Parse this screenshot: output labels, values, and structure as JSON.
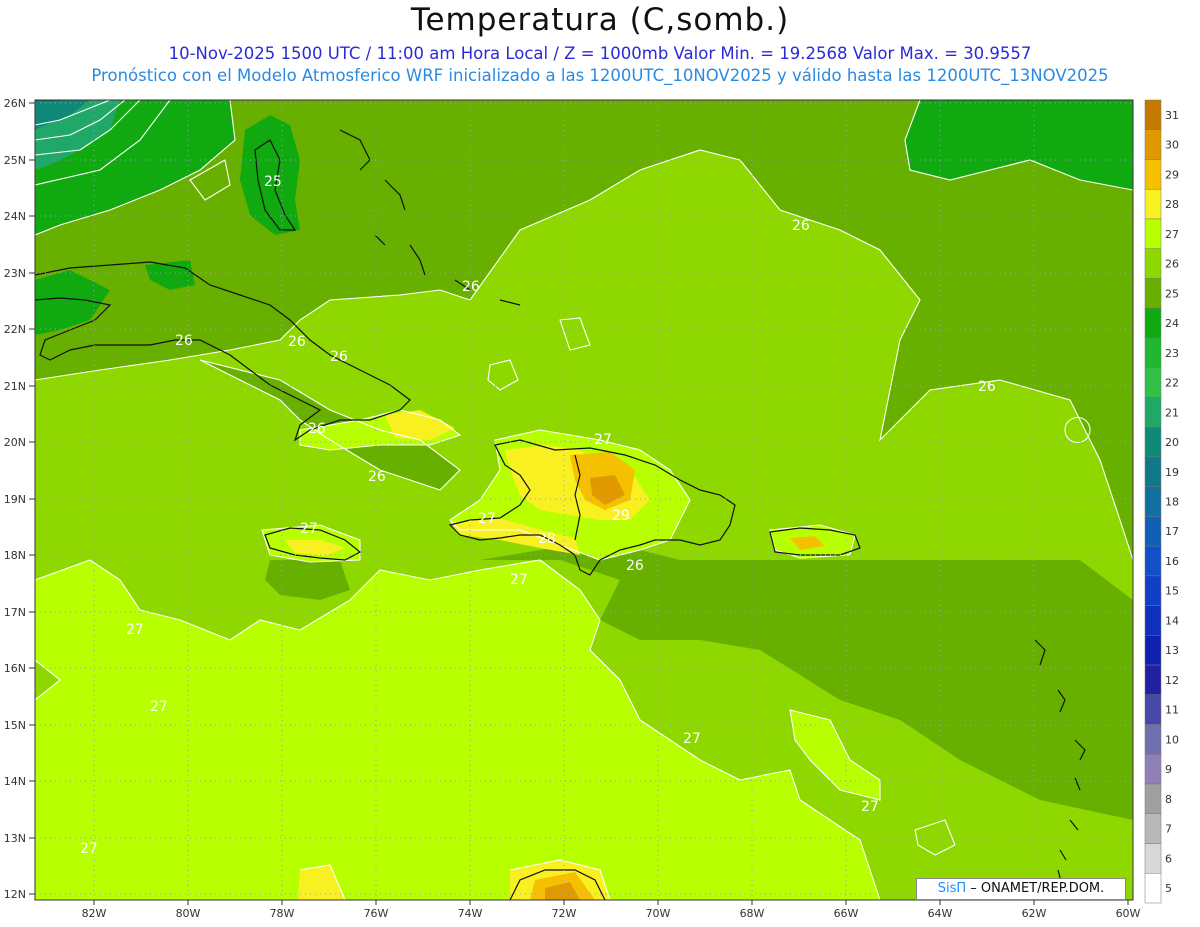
{
  "title": "Temperatura (C,somb.)",
  "subtitle_line1": "10-Nov-2025 1500 UTC / 11:00 am Hora Local / Z = 1000mb  Valor Min. = 19.2568  Valor Max. = 30.9557",
  "subtitle_line2": "Pronóstico con el Modelo Atmosferico WRF inicializado a las 1200UTC_10NOV2025 y válido hasta las  1200UTC_13NOV2025",
  "credit": {
    "brand": "SisΠ",
    "text": "– ONAMET/REP.DOM."
  },
  "axes": {
    "lat_labels": [
      "26N",
      "25N",
      "24N",
      "23N",
      "22N",
      "21N",
      "20N",
      "19N",
      "18N",
      "17N",
      "16N",
      "15N",
      "14N",
      "13N",
      "12N"
    ],
    "lon_labels": [
      "82W",
      "80W",
      "78W",
      "76W",
      "74W",
      "72W",
      "70W",
      "68W",
      "66W",
      "64W",
      "62W",
      "60W"
    ]
  },
  "colorbar": {
    "labels": [
      "31",
      "30",
      "29",
      "28",
      "27",
      "26",
      "25",
      "24",
      "23",
      "22",
      "21",
      "20",
      "19",
      "18",
      "17",
      "16",
      "15",
      "14",
      "13",
      "12",
      "11",
      "10",
      "9",
      "8",
      "7",
      "6",
      "5"
    ],
    "colors": [
      "#c47a00",
      "#e09a00",
      "#f5c000",
      "#f8f020",
      "#b8ff00",
      "#8ed800",
      "#68b000",
      "#10aa10",
      "#20b830",
      "#30c048",
      "#20a868",
      "#108878",
      "#107888",
      "#1070a0",
      "#1060b8",
      "#1050c8",
      "#1040c8",
      "#1030c0",
      "#1020b0",
      "#2020a0",
      "#4848a8",
      "#7070b0",
      "#9080b8",
      "#a0a0a0",
      "#b8b8b8",
      "#d8d8d8",
      "#ffffff"
    ]
  },
  "contour_labels": [
    {
      "text": "25"
    },
    {
      "text": "26"
    },
    {
      "text": "26"
    },
    {
      "text": "26"
    },
    {
      "text": "26"
    },
    {
      "text": "26"
    },
    {
      "text": "26"
    },
    {
      "text": "26"
    },
    {
      "text": "26"
    },
    {
      "text": "27"
    },
    {
      "text": "27"
    },
    {
      "text": "27"
    },
    {
      "text": "27"
    },
    {
      "text": "27"
    },
    {
      "text": "27"
    },
    {
      "text": "27"
    },
    {
      "text": "27"
    },
    {
      "text": "27"
    },
    {
      "text": "26"
    },
    {
      "text": "28"
    },
    {
      "text": "29"
    }
  ]
}
